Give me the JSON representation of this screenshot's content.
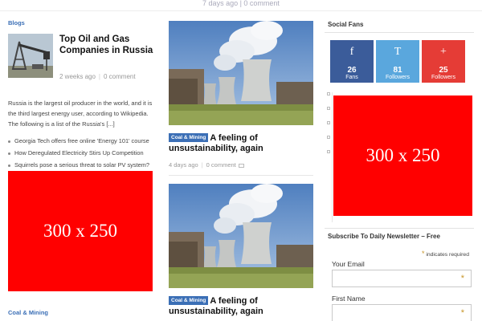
{
  "top": {
    "meta": "7 days ago  |  0 comment"
  },
  "left": {
    "section": "Blogs",
    "feature": {
      "title": "Top Oil and Gas Companies in Russia",
      "date": "2 weeks ago",
      "comments": "0 comment",
      "excerpt": "Russia is the largest oil producer in the world, and it is the third largest energy user, according to Wikipedia. The following is a list of the Russia's [...]"
    },
    "links": [
      "Georgia Tech offers free online 'Energy 101' course",
      "How Deregulated Electricity Stirs Up Competition",
      "Squirrels pose a serious threat to solar PV system?"
    ],
    "ad": "300 x 250",
    "bottom_section": "Coal & Mining"
  },
  "middle": {
    "posts": [
      {
        "category": "Coal & Mining",
        "title": "A feeling of unsustainability, again",
        "date": "4 days ago",
        "comments": "0 comment"
      },
      {
        "category": "Coal & Mining",
        "title": "A feeling of unsustainability, again"
      }
    ]
  },
  "right": {
    "social_title": "Social Fans",
    "social": [
      {
        "icon": "facebook-icon",
        "glyph": "f",
        "count": "26",
        "unit": "Fans"
      },
      {
        "icon": "twitter-icon",
        "glyph": "T",
        "count": "81",
        "unit": "Followers"
      },
      {
        "icon": "google-plus-icon",
        "glyph": "+",
        "count": "25",
        "unit": "Followers"
      }
    ],
    "ad": "300 x 250",
    "newsletter": {
      "title": "Subscribe To Daily Newsletter – Free",
      "required_note": "indicates required",
      "email_label": "Your Email",
      "first_name_label": "First Name"
    }
  },
  "colors": {
    "accent": "#3b6fb6",
    "ad": "#ff0000",
    "facebook": "#3b5c9a",
    "twitter": "#5aa7dd",
    "google": "#e53c36"
  }
}
